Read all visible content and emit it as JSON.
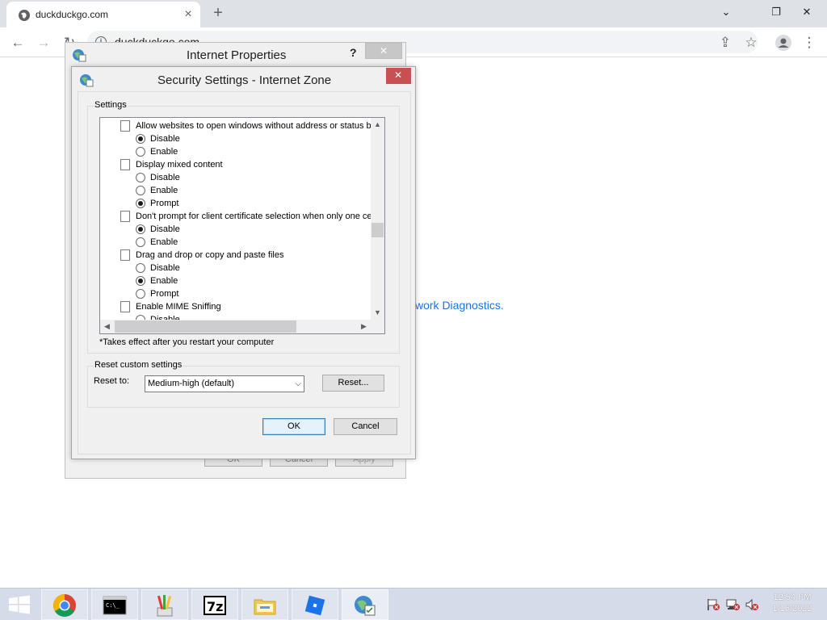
{
  "browser": {
    "tab_title": "duckduckgo.com",
    "url": "duckduckgo.com",
    "page_link_text": "work Diagnostics."
  },
  "internet_properties": {
    "title": "Internet Properties",
    "help": "?",
    "ok": "OK",
    "cancel": "Cancel",
    "apply": "Apply"
  },
  "security_settings": {
    "title": "Security Settings - Internet Zone",
    "settings_label": "Settings",
    "items": [
      {
        "type": "category",
        "label": "Allow websites to open windows without address or status bar"
      },
      {
        "type": "option",
        "label": "Disable",
        "checked": true
      },
      {
        "type": "option",
        "label": "Enable",
        "checked": false
      },
      {
        "type": "category",
        "label": "Display mixed content"
      },
      {
        "type": "option",
        "label": "Disable",
        "checked": false
      },
      {
        "type": "option",
        "label": "Enable",
        "checked": false
      },
      {
        "type": "option",
        "label": "Prompt",
        "checked": true
      },
      {
        "type": "category",
        "label": "Don't prompt for client certificate selection when only one certificate exists"
      },
      {
        "type": "option",
        "label": "Disable",
        "checked": true
      },
      {
        "type": "option",
        "label": "Enable",
        "checked": false
      },
      {
        "type": "category",
        "label": "Drag and drop or copy and paste files"
      },
      {
        "type": "option",
        "label": "Disable",
        "checked": false
      },
      {
        "type": "option",
        "label": "Enable",
        "checked": true
      },
      {
        "type": "option",
        "label": "Prompt",
        "checked": false
      },
      {
        "type": "category",
        "label": "Enable MIME Sniffing"
      },
      {
        "type": "option",
        "label": "Disable",
        "checked": false
      }
    ],
    "note": "*Takes effect after you restart your computer",
    "reset_group_label": "Reset custom settings",
    "reset_to_label": "Reset to:",
    "reset_level": "Medium-high (default)",
    "reset_button": "Reset...",
    "ok": "OK",
    "cancel": "Cancel"
  },
  "taskbar": {
    "items": [
      "chrome-icon",
      "command-prompt-icon",
      "paint-icon",
      "7zip-icon",
      "file-explorer-icon",
      "roblox-icon",
      "internet-options-icon"
    ],
    "time": "12:54 PM",
    "date": "1/16/2022"
  }
}
